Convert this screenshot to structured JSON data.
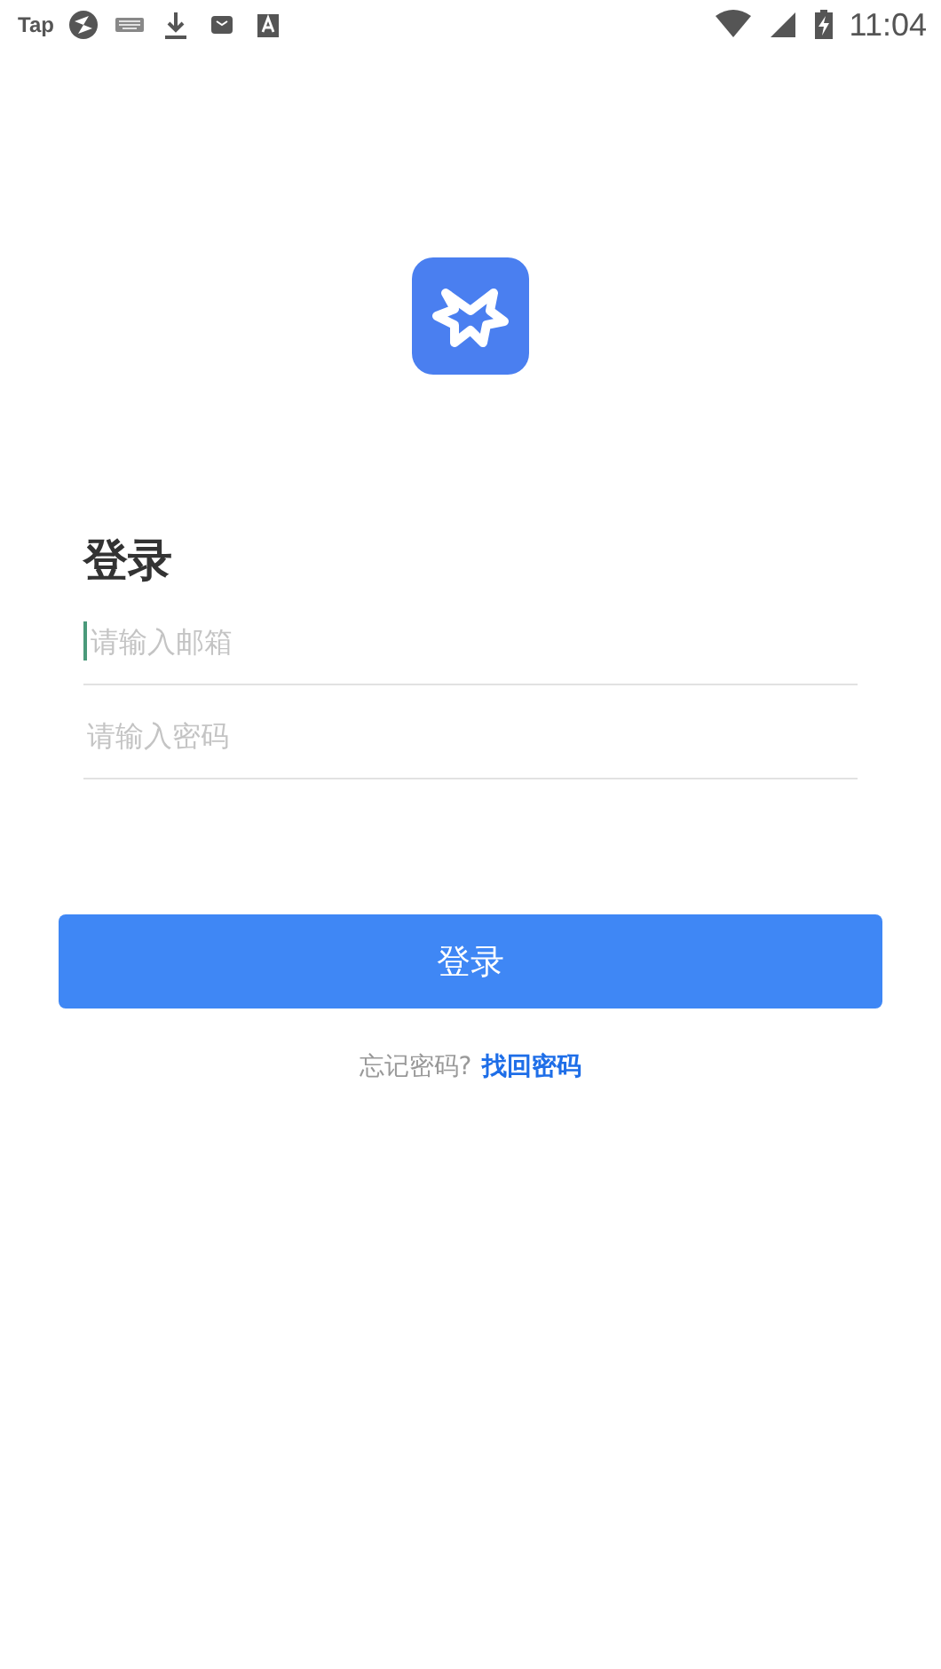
{
  "status_bar": {
    "app_label": "Tap",
    "time": "11:04"
  },
  "title": "登录",
  "fields": [
    {
      "placeholder": "请输入邮箱",
      "focused": true
    },
    {
      "placeholder": "请输入密码",
      "focused": false
    }
  ],
  "login_button": "登录",
  "forgot": {
    "prompt": "忘记密码?",
    "link": "找回密码"
  }
}
